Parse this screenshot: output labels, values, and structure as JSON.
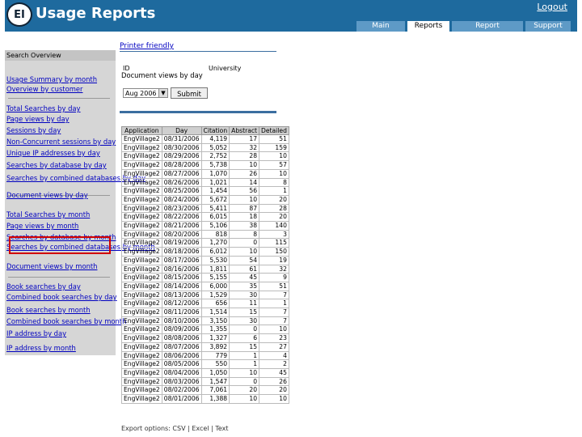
{
  "header": {
    "logo_text": "EI",
    "title": "Usage Reports",
    "logout": "Logout",
    "tabs": [
      "Main",
      "Reports",
      "Report Description",
      "Support"
    ],
    "active_tab": 1
  },
  "sidebar": {
    "heading": "Search Overview",
    "groups": [
      [
        "Usage Summary by month",
        "Overview by customer"
      ],
      [
        "Total Searches by day",
        "Page views by day",
        "Sessions by day",
        "Non-Concurrent sessions by day",
        "Unique IP addresses by day",
        "Searches by database by day",
        "Searches by combined databases by day",
        "Document views by day"
      ],
      [
        "Total Searches by month",
        "Page views by month",
        "Searches by database by month",
        "Searches by combined databases by month",
        "Document views by month"
      ],
      [
        "Book searches by day",
        "Combined book searches by day",
        "Book searches by month",
        "Combined book searches by month",
        "IP address by day",
        "IP address by month"
      ]
    ]
  },
  "main": {
    "printer_friendly": "Printer friendly",
    "id_label": "ID",
    "org": "University",
    "report_title": "Document views by day",
    "period": "Aug 2006",
    "submit": "Submit",
    "columns": [
      "Application",
      "Day",
      "Citation",
      "Abstract",
      "Detailed"
    ],
    "rows": [
      [
        "EngVillage2",
        "08/31/2006",
        "4,119",
        "17",
        "51"
      ],
      [
        "EngVillage2",
        "08/30/2006",
        "5,052",
        "32",
        "159"
      ],
      [
        "EngVillage2",
        "08/29/2006",
        "2,752",
        "28",
        "10"
      ],
      [
        "EngVillage2",
        "08/28/2006",
        "5,738",
        "10",
        "57"
      ],
      [
        "EngVillage2",
        "08/27/2006",
        "1,070",
        "26",
        "10"
      ],
      [
        "EngVillage2",
        "08/26/2006",
        "1,021",
        "14",
        "8"
      ],
      [
        "EngVillage2",
        "08/25/2006",
        "1,454",
        "56",
        "1"
      ],
      [
        "EngVillage2",
        "08/24/2006",
        "5,672",
        "10",
        "20"
      ],
      [
        "EngVillage2",
        "08/23/2006",
        "5,411",
        "87",
        "28"
      ],
      [
        "EngVillage2",
        "08/22/2006",
        "6,015",
        "18",
        "20"
      ],
      [
        "EngVillage2",
        "08/21/2006",
        "5,106",
        "38",
        "140"
      ],
      [
        "EngVillage2",
        "08/20/2006",
        "818",
        "8",
        "3"
      ],
      [
        "EngVillage2",
        "08/19/2006",
        "1,270",
        "0",
        "115"
      ],
      [
        "EngVillage2",
        "08/18/2006",
        "6,012",
        "10",
        "150"
      ],
      [
        "EngVillage2",
        "08/17/2006",
        "5,530",
        "54",
        "19"
      ],
      [
        "EngVillage2",
        "08/16/2006",
        "1,811",
        "61",
        "32"
      ],
      [
        "EngVillage2",
        "08/15/2006",
        "5,155",
        "45",
        "9"
      ],
      [
        "EngVillage2",
        "08/14/2006",
        "6,000",
        "35",
        "51"
      ],
      [
        "EngVillage2",
        "08/13/2006",
        "1,529",
        "30",
        "7"
      ],
      [
        "EngVillage2",
        "08/12/2006",
        "656",
        "11",
        "1"
      ],
      [
        "EngVillage2",
        "08/11/2006",
        "1,514",
        "15",
        "7"
      ],
      [
        "EngVillage2",
        "08/10/2006",
        "3,150",
        "30",
        "7"
      ],
      [
        "EngVillage2",
        "08/09/2006",
        "1,355",
        "0",
        "10"
      ],
      [
        "EngVillage2",
        "08/08/2006",
        "1,327",
        "6",
        "23"
      ],
      [
        "EngVillage2",
        "08/07/2006",
        "3,892",
        "15",
        "27"
      ],
      [
        "EngVillage2",
        "08/06/2006",
        "779",
        "1",
        "4"
      ],
      [
        "EngVillage2",
        "08/05/2006",
        "550",
        "1",
        "2"
      ],
      [
        "EngVillage2",
        "08/04/2006",
        "1,050",
        "10",
        "45"
      ],
      [
        "EngVillage2",
        "08/03/2006",
        "1,547",
        "0",
        "26"
      ],
      [
        "EngVillage2",
        "08/02/2006",
        "7,061",
        "20",
        "20"
      ],
      [
        "EngVillage2",
        "08/01/2006",
        "1,388",
        "10",
        "10"
      ]
    ],
    "export": "Export options: CSV | Excel | Text"
  },
  "colors": {
    "header_bg": "#1e6a9e",
    "tab_bg": "#5e9ac6",
    "sidebar_bg": "#d6d6d6",
    "link": "#0000c0",
    "highlight": "#d10000"
  }
}
